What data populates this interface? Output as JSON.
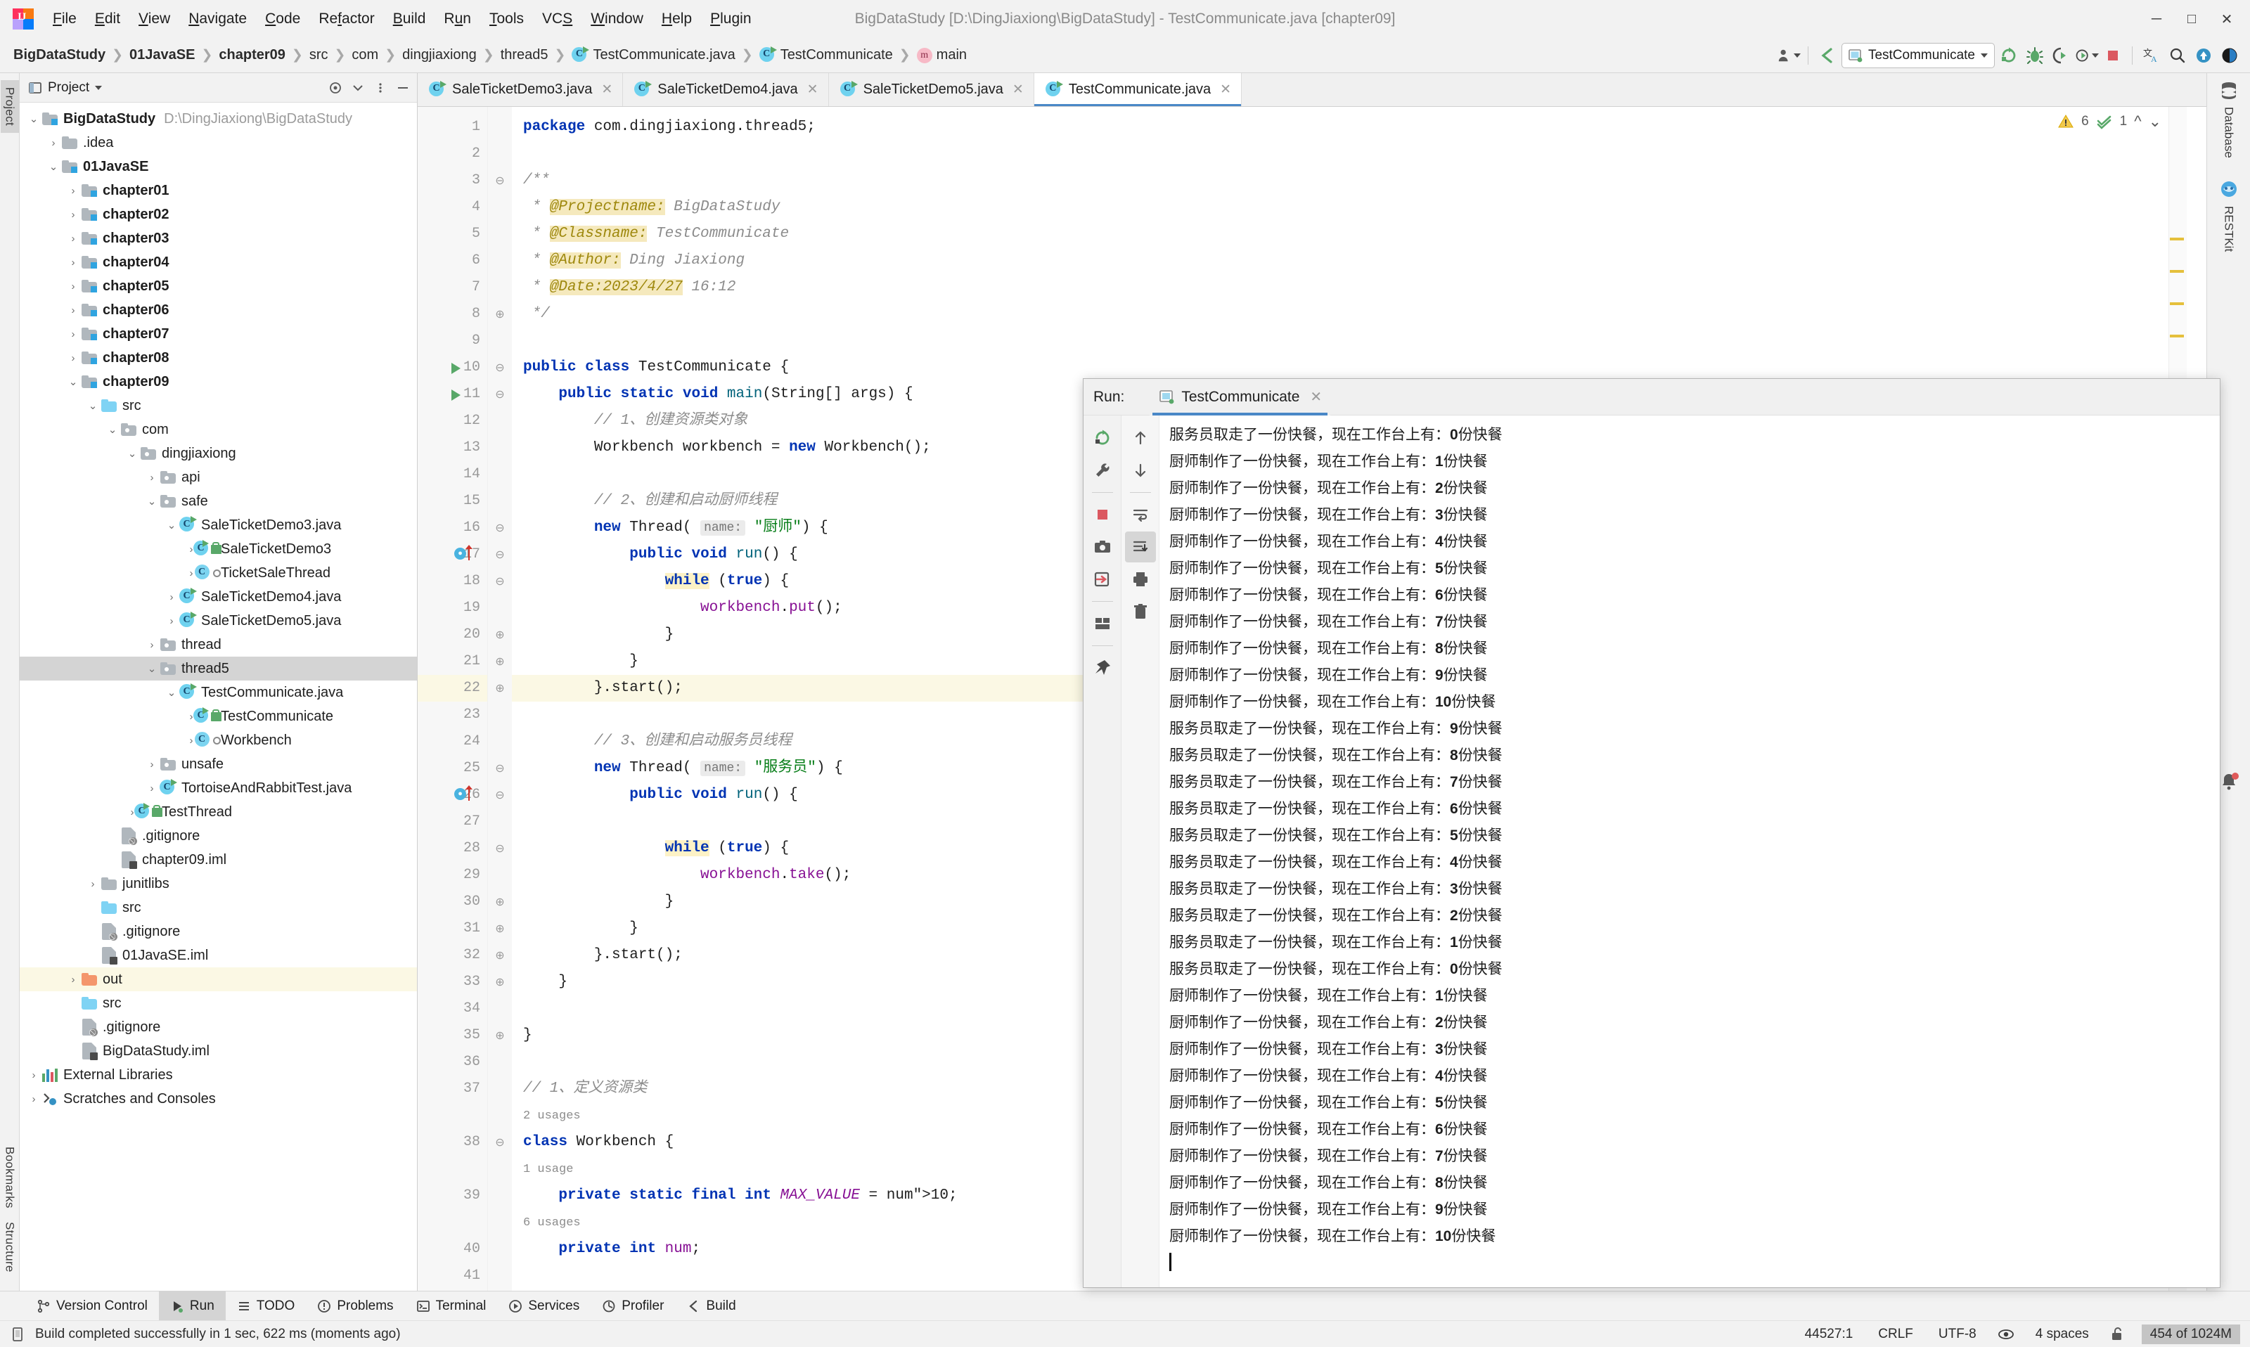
{
  "window": {
    "title": "BigDataStudy [D:\\DingJiaxiong\\BigDataStudy] - TestCommunicate.java [chapter09]",
    "minimize": "─",
    "maximize": "□",
    "close": "✕"
  },
  "menu": [
    "File",
    "Edit",
    "View",
    "Navigate",
    "Code",
    "Refactor",
    "Build",
    "Run",
    "Tools",
    "VCS",
    "Window",
    "Help",
    "Plugin"
  ],
  "breadcrumb": [
    {
      "label": "BigDataStudy",
      "bold": true
    },
    {
      "label": "01JavaSE",
      "bold": true
    },
    {
      "label": "chapter09",
      "bold": true
    },
    {
      "label": "src",
      "bold": false
    },
    {
      "label": "com",
      "bold": false
    },
    {
      "label": "dingjiaxiong",
      "bold": false
    },
    {
      "label": "thread5",
      "bold": false
    },
    {
      "label": "TestCommunicate.java",
      "bold": false,
      "icon": "java-class-icon"
    },
    {
      "label": "TestCommunicate",
      "bold": false,
      "icon": "java-class-icon"
    },
    {
      "label": "main",
      "bold": false,
      "icon": "method-icon"
    }
  ],
  "toolbar": {
    "run_configuration": "TestCommunicate",
    "icons": [
      "user-avatar-icon",
      "back-arrow-icon",
      "run-icon",
      "debug-icon",
      "run-with-coverage-icon",
      "profile-icon",
      "stop-icon",
      "translate-icon",
      "search-everywhere-icon",
      "update-project-icon",
      "ide-theme-icon"
    ]
  },
  "project_panel": {
    "title": "Project",
    "header_icons": [
      "flatten-packages-icon",
      "collapse-all-icon",
      "settings-icon",
      "hide-icon"
    ],
    "tree": [
      {
        "depth": 0,
        "arrow": "⌄",
        "icon": "module-folder",
        "label": "BigDataStudy",
        "bold": true,
        "path": "D:\\DingJiaxiong\\BigDataStudy"
      },
      {
        "depth": 1,
        "arrow": "›",
        "icon": "folder",
        "label": ".idea",
        "bold": false
      },
      {
        "depth": 1,
        "arrow": "⌄",
        "icon": "module-folder",
        "label": "01JavaSE",
        "bold": true
      },
      {
        "depth": 2,
        "arrow": "›",
        "icon": "module-folder",
        "label": "chapter01",
        "bold": true
      },
      {
        "depth": 2,
        "arrow": "›",
        "icon": "module-folder",
        "label": "chapter02",
        "bold": true
      },
      {
        "depth": 2,
        "arrow": "›",
        "icon": "module-folder",
        "label": "chapter03",
        "bold": true
      },
      {
        "depth": 2,
        "arrow": "›",
        "icon": "module-folder",
        "label": "chapter04",
        "bold": true
      },
      {
        "depth": 2,
        "arrow": "›",
        "icon": "module-folder",
        "label": "chapter05",
        "bold": true
      },
      {
        "depth": 2,
        "arrow": "›",
        "icon": "module-folder",
        "label": "chapter06",
        "bold": true
      },
      {
        "depth": 2,
        "arrow": "›",
        "icon": "module-folder",
        "label": "chapter07",
        "bold": true
      },
      {
        "depth": 2,
        "arrow": "›",
        "icon": "module-folder",
        "label": "chapter08",
        "bold": true
      },
      {
        "depth": 2,
        "arrow": "⌄",
        "icon": "module-folder",
        "label": "chapter09",
        "bold": true
      },
      {
        "depth": 3,
        "arrow": "⌄",
        "icon": "source-folder",
        "label": "src",
        "bold": false
      },
      {
        "depth": 4,
        "arrow": "⌄",
        "icon": "package",
        "label": "com",
        "bold": false
      },
      {
        "depth": 5,
        "arrow": "⌄",
        "icon": "package",
        "label": "dingjiaxiong",
        "bold": false
      },
      {
        "depth": 6,
        "arrow": "›",
        "icon": "package",
        "label": "api",
        "bold": false
      },
      {
        "depth": 6,
        "arrow": "⌄",
        "icon": "package",
        "label": "safe",
        "bold": false
      },
      {
        "depth": 7,
        "arrow": "⌄",
        "icon": "runnable-class",
        "label": "SaleTicketDemo3.java",
        "bold": false
      },
      {
        "depth": 8,
        "arrow": "›",
        "icon": "runnable-class-public",
        "label": "SaleTicketDemo3",
        "bold": false
      },
      {
        "depth": 8,
        "arrow": "›",
        "icon": "class-package-private",
        "label": "TicketSaleThread",
        "bold": false
      },
      {
        "depth": 7,
        "arrow": "›",
        "icon": "runnable-class",
        "label": "SaleTicketDemo4.java",
        "bold": false
      },
      {
        "depth": 7,
        "arrow": "›",
        "icon": "runnable-class",
        "label": "SaleTicketDemo5.java",
        "bold": false
      },
      {
        "depth": 6,
        "arrow": "›",
        "icon": "package",
        "label": "thread",
        "bold": false
      },
      {
        "depth": 6,
        "arrow": "⌄",
        "icon": "package",
        "label": "thread5",
        "bold": false,
        "selected": true
      },
      {
        "depth": 7,
        "arrow": "⌄",
        "icon": "runnable-class",
        "label": "TestCommunicate.java",
        "bold": false
      },
      {
        "depth": 8,
        "arrow": "›",
        "icon": "runnable-class-public",
        "label": "TestCommunicate",
        "bold": false
      },
      {
        "depth": 8,
        "arrow": "›",
        "icon": "class-package-private",
        "label": "Workbench",
        "bold": false
      },
      {
        "depth": 6,
        "arrow": "›",
        "icon": "package",
        "label": "unsafe",
        "bold": false
      },
      {
        "depth": 6,
        "arrow": "›",
        "icon": "runnable-class",
        "label": "TortoiseAndRabbitTest.java",
        "bold": false
      },
      {
        "depth": 5,
        "arrow": "›",
        "icon": "runnable-class-public",
        "label": "TestThread",
        "bold": false
      },
      {
        "depth": 4,
        "arrow": "",
        "icon": "gitignore-file",
        "label": ".gitignore",
        "bold": false
      },
      {
        "depth": 4,
        "arrow": "",
        "icon": "iml-file",
        "label": "chapter09.iml",
        "bold": false
      },
      {
        "depth": 3,
        "arrow": "›",
        "icon": "folder",
        "label": "junitlibs",
        "bold": false
      },
      {
        "depth": 3,
        "arrow": "",
        "icon": "source-folder",
        "label": "src",
        "bold": false
      },
      {
        "depth": 3,
        "arrow": "",
        "icon": "gitignore-file",
        "label": ".gitignore",
        "bold": false
      },
      {
        "depth": 3,
        "arrow": "",
        "icon": "iml-file",
        "label": "01JavaSE.iml",
        "bold": false
      },
      {
        "depth": 2,
        "arrow": "›",
        "icon": "out-folder",
        "label": "out",
        "bold": false,
        "highlight": true
      },
      {
        "depth": 2,
        "arrow": "",
        "icon": "source-folder",
        "label": "src",
        "bold": false
      },
      {
        "depth": 2,
        "arrow": "",
        "icon": "gitignore-file",
        "label": ".gitignore",
        "bold": false
      },
      {
        "depth": 2,
        "arrow": "",
        "icon": "iml-file",
        "label": "BigDataStudy.iml",
        "bold": false
      },
      {
        "depth": 0,
        "arrow": "›",
        "icon": "external-libraries",
        "label": "External Libraries",
        "bold": false
      },
      {
        "depth": 0,
        "arrow": "›",
        "icon": "scratches",
        "label": "Scratches and Consoles",
        "bold": false
      }
    ]
  },
  "editor": {
    "tabs": [
      {
        "label": "SaleTicketDemo3.java",
        "active": false
      },
      {
        "label": "SaleTicketDemo4.java",
        "active": false
      },
      {
        "label": "SaleTicketDemo5.java",
        "active": false
      },
      {
        "label": "TestCommunicate.java",
        "active": true
      }
    ],
    "inspection": {
      "warnings": "6",
      "checks": "1"
    },
    "lines": [
      {
        "n": 1,
        "text": "package com.dingjiaxiong.thread5;"
      },
      {
        "n": 2,
        "text": ""
      },
      {
        "n": 3,
        "text": "/**"
      },
      {
        "n": 4,
        "text": " * @Projectname: BigDataStudy"
      },
      {
        "n": 5,
        "text": " * @Classname: TestCommunicate"
      },
      {
        "n": 6,
        "text": " * @Author: Ding Jiaxiong"
      },
      {
        "n": 7,
        "text": " * @Date:2023/4/27 16:12"
      },
      {
        "n": 8,
        "text": " */"
      },
      {
        "n": 9,
        "text": ""
      },
      {
        "n": 10,
        "text": "public class TestCommunicate {"
      },
      {
        "n": 11,
        "text": "    public static void main(String[] args) {"
      },
      {
        "n": 12,
        "text": "        // 1、创建资源类对象"
      },
      {
        "n": 13,
        "text": "        Workbench workbench = new Workbench();"
      },
      {
        "n": 14,
        "text": ""
      },
      {
        "n": 15,
        "text": "        // 2、创建和启动厨师线程"
      },
      {
        "n": 16,
        "text": "        new Thread( name: \"厨师\") {"
      },
      {
        "n": 17,
        "text": "            public void run() {"
      },
      {
        "n": 18,
        "text": "                while (true) {"
      },
      {
        "n": 19,
        "text": "                    workbench.put();"
      },
      {
        "n": 20,
        "text": "                }"
      },
      {
        "n": 21,
        "text": "            }"
      },
      {
        "n": 22,
        "text": "        }.start();"
      },
      {
        "n": 23,
        "text": ""
      },
      {
        "n": 24,
        "text": "        // 3、创建和启动服务员线程"
      },
      {
        "n": 25,
        "text": "        new Thread( name: \"服务员\") {"
      },
      {
        "n": 26,
        "text": "            public void run() {"
      },
      {
        "n": 27,
        "text": ""
      },
      {
        "n": 28,
        "text": "                while (true) {"
      },
      {
        "n": 29,
        "text": "                    workbench.take();"
      },
      {
        "n": 30,
        "text": "                }"
      },
      {
        "n": 31,
        "text": "            }"
      },
      {
        "n": 32,
        "text": "        }.start();"
      },
      {
        "n": 33,
        "text": "    }"
      },
      {
        "n": 34,
        "text": ""
      },
      {
        "n": 35,
        "text": "}"
      },
      {
        "n": 36,
        "text": ""
      },
      {
        "n": 37,
        "text": "// 1、定义资源类"
      },
      {
        "n": 38,
        "text": "class Workbench {",
        "hint_above": "2 usages"
      },
      {
        "n": 39,
        "text": "    private static final int MAX_VALUE = 10;",
        "hint_above": "1 usage"
      },
      {
        "n": 40,
        "text": "    private int num;",
        "hint_above": "6 usages"
      },
      {
        "n": 41,
        "text": ""
      }
    ]
  },
  "run_panel": {
    "label": "Run:",
    "tab": "TestCommunicate",
    "close": "✕",
    "rail_left_icons": [
      "rerun-icon",
      "settings-wrench-icon",
      "stop-icon",
      "screenshot-icon",
      "export-icon",
      "layout-icon",
      "pin-icon"
    ],
    "rail_right_icons": [
      "scroll-up-icon",
      "scroll-down-icon",
      "soft-wrap-icon",
      "scroll-to-end-icon",
      "print-icon",
      "clear-all-icon"
    ],
    "console": [
      "服务员取走了一份快餐，现在工作台上有：0份快餐",
      "厨师制作了一份快餐，现在工作台上有：1份快餐",
      "厨师制作了一份快餐，现在工作台上有：2份快餐",
      "厨师制作了一份快餐，现在工作台上有：3份快餐",
      "厨师制作了一份快餐，现在工作台上有：4份快餐",
      "厨师制作了一份快餐，现在工作台上有：5份快餐",
      "厨师制作了一份快餐，现在工作台上有：6份快餐",
      "厨师制作了一份快餐，现在工作台上有：7份快餐",
      "厨师制作了一份快餐，现在工作台上有：8份快餐",
      "厨师制作了一份快餐，现在工作台上有：9份快餐",
      "厨师制作了一份快餐，现在工作台上有：10份快餐",
      "服务员取走了一份快餐，现在工作台上有：9份快餐",
      "服务员取走了一份快餐，现在工作台上有：8份快餐",
      "服务员取走了一份快餐，现在工作台上有：7份快餐",
      "服务员取走了一份快餐，现在工作台上有：6份快餐",
      "服务员取走了一份快餐，现在工作台上有：5份快餐",
      "服务员取走了一份快餐，现在工作台上有：4份快餐",
      "服务员取走了一份快餐，现在工作台上有：3份快餐",
      "服务员取走了一份快餐，现在工作台上有：2份快餐",
      "服务员取走了一份快餐，现在工作台上有：1份快餐",
      "服务员取走了一份快餐，现在工作台上有：0份快餐",
      "厨师制作了一份快餐，现在工作台上有：1份快餐",
      "厨师制作了一份快餐，现在工作台上有：2份快餐",
      "厨师制作了一份快餐，现在工作台上有：3份快餐",
      "厨师制作了一份快餐，现在工作台上有：4份快餐",
      "厨师制作了一份快餐，现在工作台上有：5份快餐",
      "厨师制作了一份快餐，现在工作台上有：6份快餐",
      "厨师制作了一份快餐，现在工作台上有：7份快餐",
      "厨师制作了一份快餐，现在工作台上有：8份快餐",
      "厨师制作了一份快餐，现在工作台上有：9份快餐",
      "厨师制作了一份快餐，现在工作台上有：10份快餐"
    ]
  },
  "left_rail": [
    "Project",
    "Bookmarks",
    "Structure"
  ],
  "right_rail": [
    "Database",
    "RESTKit"
  ],
  "tool_windows": [
    {
      "label": "Version Control",
      "icon": "branch-icon",
      "active": false
    },
    {
      "label": "Run",
      "icon": "run-icon",
      "active": true
    },
    {
      "label": "TODO",
      "icon": "todo-icon",
      "active": false
    },
    {
      "label": "Problems",
      "icon": "problems-icon",
      "active": false
    },
    {
      "label": "Terminal",
      "icon": "terminal-icon",
      "active": false
    },
    {
      "label": "Services",
      "icon": "services-icon",
      "active": false
    },
    {
      "label": "Profiler",
      "icon": "profiler-icon",
      "active": false
    },
    {
      "label": "Build",
      "icon": "build-icon",
      "active": false
    }
  ],
  "status_bar": {
    "message": "Build completed successfully in 1 sec, 622 ms (moments ago)",
    "caret": "44527:1",
    "line_sep": "CRLF",
    "encoding": "UTF-8",
    "indent": "4 spaces",
    "memory": "454 of 1024M"
  },
  "colors": {
    "accent_blue": "#4a88c7",
    "green_run": "#59a869",
    "red_stop": "#db5860",
    "keyword": "#0033b3",
    "string": "#067d17",
    "comment": "#8c8c8c",
    "field": "#871094",
    "highlight": "#fbf8e4"
  }
}
